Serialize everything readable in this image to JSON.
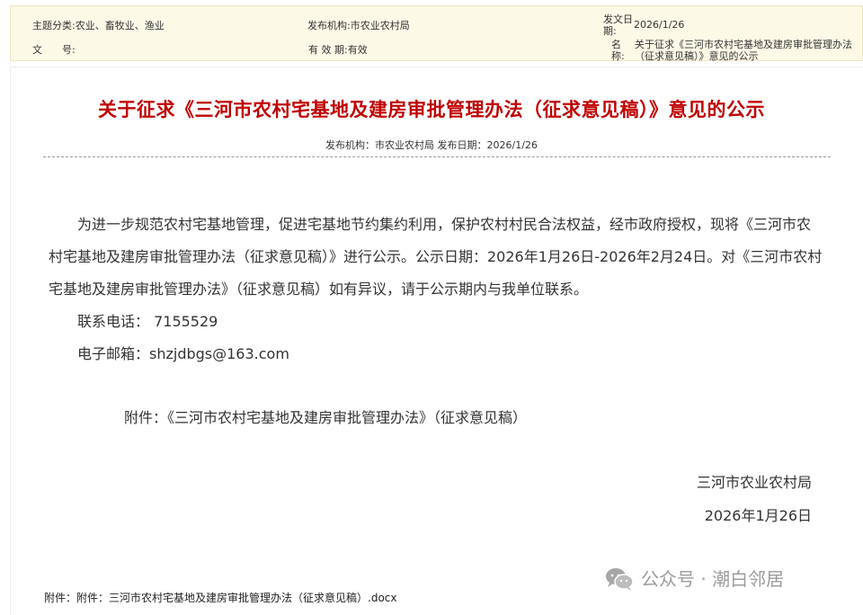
{
  "meta": {
    "topic_label": "主题分类:",
    "topic_value": "农业、畜牧业、渔业",
    "agency_label": "发布机构:",
    "agency_value": "市农业农村局",
    "docno_label": "文　　号:",
    "docno_value": "",
    "validity_label": "有 效 期:",
    "validity_value": "有效",
    "date_label": "发文日期:",
    "date_value": "2026/1/26",
    "name_label": "名　　称:",
    "name_value": "关于征求《三河市农村宅基地及建房审批管理办法（征求意见稿）》意见的公示"
  },
  "document": {
    "title": "关于征求《三河市农村宅基地及建房审批管理办法（征求意见稿）》意见的公示",
    "pub_line": "发布机构：市农业农村局 发布日期：2026/1/26",
    "paragraph": "为进一步规范农村宅基地管理，促进宅基地节约集约利用，保护农村村民合法权益，经市政府授权，现将《三河市农村宅基地及建房审批管理办法（征求意见稿）》进行公示。公示日期：2026年1月26日-2026年2月24日。对《三河市农村宅基地及建房审批管理办法》（征求意见稿）如有异议，请于公示期内与我单位联系。",
    "phone": "联系电话：  7155529",
    "email": "电子邮箱：shzjdbgs@163.com",
    "attachment_line": "附件：《三河市农村宅基地及建房审批管理办法》（征求意见稿）",
    "signature_org": "三河市农业农村局",
    "signature_date": "2026年1月26日",
    "attachment_file_label": "附件：",
    "attachment_file_link": "附件：三河市农村宅基地及建房审批管理办法（征求意见稿）.docx"
  },
  "watermark": {
    "icon": "wechat-icon",
    "text": "公众号 · 潮白邻居"
  }
}
